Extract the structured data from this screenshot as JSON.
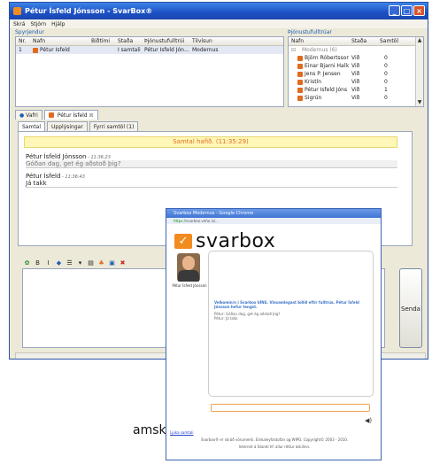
{
  "window": {
    "title": "Pétur Ísfeld Jónsson - SvarBox®"
  },
  "menu": [
    "Skrá",
    "Stjórn",
    "Hjálp"
  ],
  "waiting": {
    "label": "Spyrjendur",
    "columns": [
      "Nr.",
      "Nafn",
      "Biðtími",
      "Staða",
      "Þjónustufulltrúi",
      "Tilvísun"
    ],
    "rows": [
      {
        "nr": "1",
        "name": "Pétur Ísfeld",
        "wait": "",
        "status": "Í samtali",
        "agent": "Pétur Ísfeld Jón...",
        "ref": "Modernus"
      }
    ]
  },
  "agents": {
    "label": "Þjónustufulltrúar",
    "columns": [
      "Nafn",
      "Staða",
      "Samtöl"
    ],
    "group": "Modernus (6)",
    "rows": [
      {
        "name": "Björn Róbertsson",
        "status": "Við",
        "count": "0"
      },
      {
        "name": "Einar Bjarni Hallo",
        "status": "Við",
        "count": "0"
      },
      {
        "name": "Jens P. Jensen",
        "status": "Við",
        "count": "0"
      },
      {
        "name": "Kristín",
        "status": "Við",
        "count": "0"
      },
      {
        "name": "Pétur Ísfeld Jóns",
        "status": "Við",
        "count": "1"
      },
      {
        "name": "Sigrún",
        "status": "Við",
        "count": "0"
      }
    ]
  },
  "tabs": [
    "Vafri",
    "Pétur Ísfeld"
  ],
  "subtabs": [
    "Samtal",
    "Upplýsingar",
    "Fyrri samtöl (1)"
  ],
  "chat": {
    "banner": "Samtal hafið. (11:35:29)",
    "messages": [
      {
        "name": "Pétur Ísfeld Jónsson",
        "time": " - 11:36:23",
        "text": "Góðan dag, get ég aðstoð þig?"
      },
      {
        "name": "Pétur Ísfeld",
        "time": " - 11:36:43",
        "text": "Já takk"
      }
    ]
  },
  "send_label": "Senda",
  "browser": {
    "title": "Svarbox Modernus - Google Chrome",
    "url_secure": "https://",
    "url_rest": "svarbox.vefur.is/...",
    "logo_text": "svarbox",
    "agent_name": "Pétur Ísfeld Jónsson",
    "welcome": "Velkomin/n í Svarbox ÞÍNS. Vinsamlegast bíðið eftir fulltrúa. Pétur Ísfeld Jónsson hefur tengst.",
    "msg_line1": "Pétur: Góðan dag, get ég aðstoð þig?",
    "msg_line2": "Pétur: Já takk",
    "end_link": "Ljúka samtali",
    "footer1": "Svarbox® er skráð vörumerki. Einkaleyfastofan og WIPO. Copyright© 2003 - 2010.",
    "footer2": "Internet á Íslandi hf. allur réttur áskilinn."
  },
  "background_text": "amskipti fyrir"
}
